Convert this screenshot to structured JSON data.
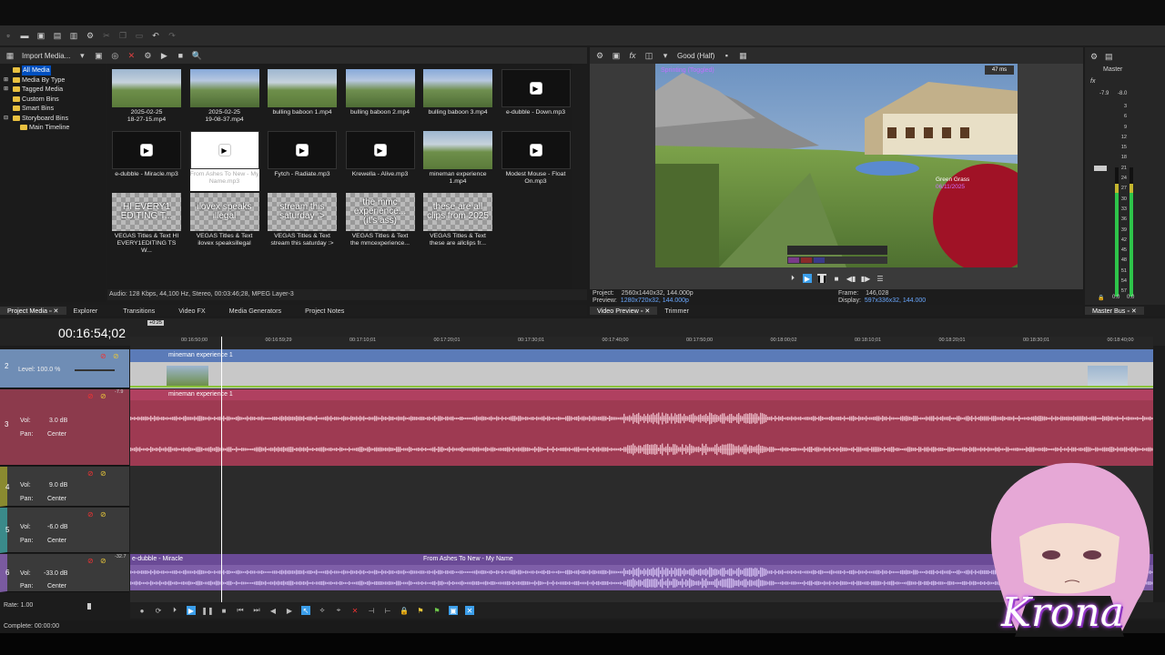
{
  "media": {
    "import_label": "Import Media...",
    "tree": [
      "All Media",
      "Media By Type",
      "Tagged Media",
      "Custom Bins",
      "Smart Bins",
      "Storyboard Bins",
      "Main Timeline"
    ],
    "tiles": [
      {
        "label": "2025-02-25\n18-27-15.mp4",
        "kind": "mc"
      },
      {
        "label": "2025-02-25\n19-08-37.mp4",
        "kind": "mc2"
      },
      {
        "label": "bulling baboon 1.mp4",
        "kind": "mc"
      },
      {
        "label": "bulling baboon 2.mp4",
        "kind": "mc2"
      },
      {
        "label": "bulling baboon 3.mp4",
        "kind": "mc2"
      },
      {
        "label": "e-dubble - Down.mp3",
        "kind": "audio"
      },
      {
        "label": "e-dubble - Miracle.mp3",
        "kind": "audio"
      },
      {
        "label": "From Ashes To New - My\nName.mp3",
        "kind": "audio-sel"
      },
      {
        "label": "Fytch - Radiate.mp3",
        "kind": "audio"
      },
      {
        "label": "Krewella - Alive.mp3",
        "kind": "audio"
      },
      {
        "label": "mineman experience\n1.mp4",
        "kind": "mc"
      },
      {
        "label": "Modest Mouse - Float\nOn.mp3",
        "kind": "audio"
      },
      {
        "label": "VEGAS Titles & Text HI\nEVERY1EDITING TS W...",
        "kind": "title",
        "overlay": "HI EVERY1 EDITING T..."
      },
      {
        "label": "VEGAS Titles & Text\nilovex speaksillegal",
        "kind": "title",
        "overlay": "ilovex speaks illegal"
      },
      {
        "label": "VEGAS Titles & Text\nstream this saturday :>",
        "kind": "title",
        "overlay": "stream this saturday :>"
      },
      {
        "label": "VEGAS Titles & Text\nthe mmcexperience...",
        "kind": "title",
        "overlay": "the mmc experience... (it's ass)"
      },
      {
        "label": "VEGAS Titles & Text\nthese are allclips fr...",
        "kind": "title",
        "overlay": "these are all clips from 2025"
      }
    ],
    "audio_info": "Audio: 128 Kbps, 44,100 Hz, Stereo, 00:03:46;28, MPEG Layer-3",
    "tabs": [
      "Project Media",
      "Explorer",
      "Transitions",
      "Video FX",
      "Media Generators",
      "Project Notes"
    ]
  },
  "preview": {
    "quality": "Good (Half)",
    "overlay_top": "Sprinting (Toggled)",
    "ms": "47 ms",
    "overlay_right": [
      "Green Grass",
      "06/11/2025"
    ],
    "project_label": "Project:",
    "project_value": "2560x1440x32, 144.000p",
    "preview_label": "Preview:",
    "preview_value": "1280x720x32, 144.000p",
    "frame_label": "Frame:",
    "frame_value": "146,028",
    "display_label": "Display:",
    "display_value": "597x336x32, 144.000",
    "tabs": [
      "Video Preview",
      "Trimmer"
    ]
  },
  "master": {
    "title": "Master",
    "peak_l": "-7.9",
    "peak_r": "-8.0",
    "scale": [
      "3",
      "6",
      "9",
      "12",
      "15",
      "18",
      "21",
      "24",
      "27",
      "30",
      "33",
      "36",
      "39",
      "42",
      "45",
      "48",
      "51",
      "54",
      "57"
    ],
    "bottom_l": "0.0",
    "bottom_r": "0.0",
    "tab": "Master Bus"
  },
  "timeline": {
    "timecode": "00:16:54;02",
    "ruler": [
      "00:16:50;00",
      "00:16:59;29",
      "00:17:10;01",
      "00:17:20;01",
      "00:17:30;01",
      "00:17:40;00",
      "00:17:50;00",
      "00:18:00;02",
      "00:18:10;01",
      "00:18:20;01",
      "00:18:30;01",
      "00:18:40;00"
    ],
    "loop_marker": "+0:25",
    "tracks": [
      {
        "num": "2",
        "type": "video",
        "level_label": "Level: 100.0 %",
        "clip": "mineman experience 1",
        "color": "#7a9cc6"
      },
      {
        "num": "3",
        "type": "audio",
        "vol": "3.0 dB",
        "pan": "Center",
        "peak": "-7.9",
        "clip": "mineman experience 1",
        "color": "#b04a5f"
      },
      {
        "num": "4",
        "type": "empty",
        "vol": "9.0 dB",
        "pan": "Center",
        "color": "#8a8a30"
      },
      {
        "num": "5",
        "type": "empty",
        "vol": "-6.0 dB",
        "pan": "Center",
        "color": "#3a8a8a"
      },
      {
        "num": "6",
        "type": "audio2",
        "vol": "-33.0 dB",
        "pan": "Center",
        "peak": "-32.7",
        "clip": "e-dubble - Miracle",
        "clip2": "From Ashes To New - My Name",
        "color": "#7a5aa0"
      }
    ],
    "vol_label": "Vol:",
    "pan_label": "Pan:",
    "rate": "Rate: 1.00"
  },
  "status": "Complete: 00:00:00",
  "overlay_name": "Krona"
}
